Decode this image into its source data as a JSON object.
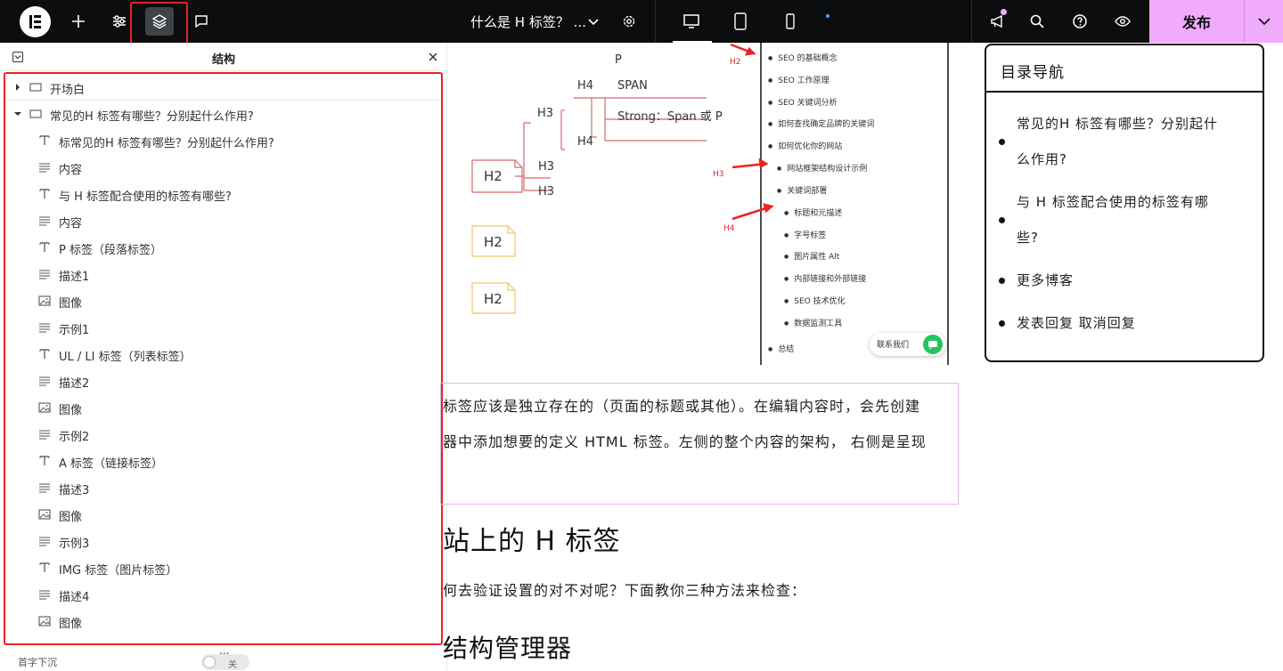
{
  "topbar": {
    "page_title": "什么是 H 标签？ ...",
    "publish_label": "发布"
  },
  "panel": {
    "title": "结构",
    "items": [
      {
        "label": "开场白"
      },
      {
        "label": "常见的H 标签有哪些？分别起什么作用?"
      },
      {
        "label": "标常见的H 标签有哪些？分别起什么作用?"
      },
      {
        "label": "内容"
      },
      {
        "label": "与 H 标签配合使用的标签有哪些?"
      },
      {
        "label": "内容"
      },
      {
        "label": "P 标签（段落标签）"
      },
      {
        "label": "描述1"
      },
      {
        "label": "图像"
      },
      {
        "label": "示例1"
      },
      {
        "label": "UL / LI 标签（列表标签）"
      },
      {
        "label": "描述2"
      },
      {
        "label": "图像"
      },
      {
        "label": "示例2"
      },
      {
        "label": "A 标签（链接标签）"
      },
      {
        "label": "描述3"
      },
      {
        "label": "图像"
      },
      {
        "label": "示例3"
      },
      {
        "label": "IMG 标签（图片标签）"
      },
      {
        "label": "描述4"
      },
      {
        "label": "图像"
      }
    ],
    "more": "...",
    "footer_label": "首字下沉",
    "footer_toggle": "关"
  },
  "canvas": {
    "diagram": {
      "p": "P",
      "span": "SPAN",
      "strong": "Strong：Span 或 P",
      "h4a": "H4",
      "h4b": "H4",
      "h3a": "H3",
      "h3b": "H3",
      "h3c": "H3",
      "h2a": "H2",
      "h2b": "H2",
      "h2c": "H2"
    },
    "mini_toc": [
      "SEO 的基础概念",
      "SEO 工作原理",
      "SEO 关键词分析",
      "如何查找确定品牌的关键词",
      "如何优化你的网站",
      "网站框架结构设计示例",
      "关键词部署",
      "标题和元描述",
      "字号标签",
      "图片属性 Alt",
      "内部链接和外部链接",
      "SEO 技术优化",
      "数据监测工具",
      "总结"
    ],
    "arrow_labels": {
      "h2": "H2",
      "h3": "H3",
      "h4": "H4"
    },
    "chat_label": "联系我们",
    "para1": "标签应该是独立存在的（页面的标题或其他）。在编辑内容时，会先创建",
    "para2": "器中添加想要的定义 HTML 标签。左侧的整个内容的架构， 右侧是呈现",
    "heading1": "站上的 H 标签",
    "para3": "何去验证设置的对不对呢？下面教你三种方法来检查：",
    "heading2": "结构管理器"
  },
  "toc": {
    "title": "目录导航",
    "items": [
      {
        "line1": "常见的H 标签有哪些？分别起什",
        "line2": "么作用?"
      },
      {
        "line1": "与 H 标签配合使用的标签有哪",
        "line2": "些?"
      },
      {
        "line1": "更多博客",
        "line2": ""
      },
      {
        "line1": "发表回复 取消回复",
        "line2": ""
      }
    ]
  },
  "colors": {
    "accent": "#f0abfc",
    "highlight": "#e22222",
    "diagram_red": "#d9686a",
    "diagram_yellow": "#f1c46a"
  }
}
